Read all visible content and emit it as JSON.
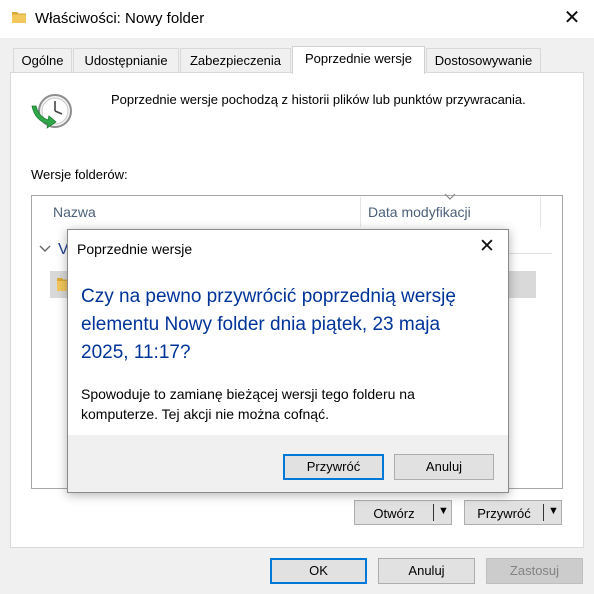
{
  "window": {
    "title": "Właściwości: Nowy folder",
    "close_glyph": "✕"
  },
  "tabs": [
    {
      "label": "Ogólne"
    },
    {
      "label": "Udostępnianie"
    },
    {
      "label": "Zabezpieczenia"
    },
    {
      "label": "Poprzednie wersje",
      "active": true
    },
    {
      "label": "Dostosowywanie"
    }
  ],
  "panel": {
    "info_text": "Poprzednie wersje pochodzą z historii plików lub punktów przywracania.",
    "versions_label": "Wersje folderów:",
    "columns": {
      "name": "Nazwa",
      "date": "Data modyfikacji"
    },
    "group_partial": "V",
    "open_button": "Otwórz",
    "restore_button": "Przywróć",
    "dropdown_arrow": "▼"
  },
  "footer": {
    "ok": "OK",
    "cancel": "Anuluj",
    "apply": "Zastosuj"
  },
  "dialog": {
    "title": "Poprzednie wersje",
    "close_glyph": "✕",
    "heading": "Czy na pewno przywrócić poprzednią wersję elementu Nowy folder dnia piątek, 23 maja 2025, 11:17?",
    "body": "Spowoduje to zamianę bieżącej wersji tego folderu na komputerze. Tej akcji nie można cofnąć.",
    "restore_button": "Przywróć",
    "cancel_button": "Anuluj"
  },
  "colors": {
    "accent": "#0078d7",
    "heading": "#003399",
    "folder": "#e8b84a"
  },
  "icons": [
    "folder-icon",
    "restore-clock-icon",
    "close-icon",
    "chevron-down-icon",
    "dropdown-arrow-icon"
  ]
}
